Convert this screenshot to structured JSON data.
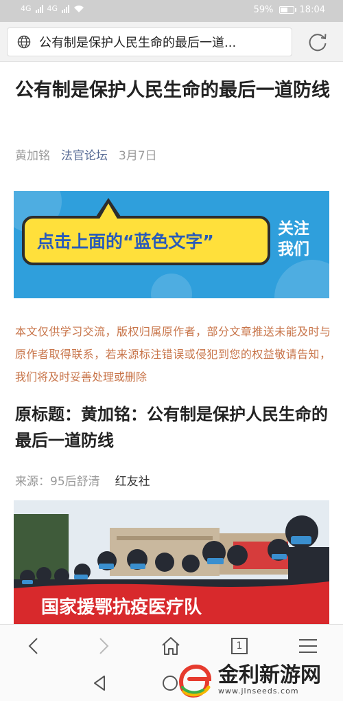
{
  "status_bar": {
    "network_1": "4G",
    "network_2": "4G",
    "battery": "59%",
    "battery_level": 0.59,
    "time": "18:04"
  },
  "address_bar": {
    "title": "公有制是保护人民生命的最后一道..."
  },
  "article": {
    "title": "公有制是保护人民生命的最后一道防线",
    "author": "黄加铭",
    "account": "法官论坛",
    "date": "3月7日",
    "banner": {
      "bubble_text": "点击上面的“蓝色文字”",
      "follow_text_1": "关注",
      "follow_text_2": "我们"
    },
    "notice": "本文仅供学习交流，版权归属原作者，部分文章推送未能及时与原作者取得联系，若来源标注错误或侵犯到您的权益敬请告知，我们将及时妥善处理或删除",
    "original_title": "原标题：黄加铭：公有制是保护人民生命的最后一道防线",
    "source_label": "来源：95后舒清",
    "publisher": "红友社",
    "photo_banner_text": "国家援鄂抗疫医疗队"
  },
  "toolbar": {
    "tab_count": "1"
  },
  "watermark": {
    "text": "金利新游网",
    "url": "www.jlnseeds.com"
  },
  "colors": {
    "link_blue": "#576b95",
    "notice_orange": "#c8754a",
    "banner_blue": "#2f9fdc",
    "bubble_yellow": "#ffe03b"
  }
}
